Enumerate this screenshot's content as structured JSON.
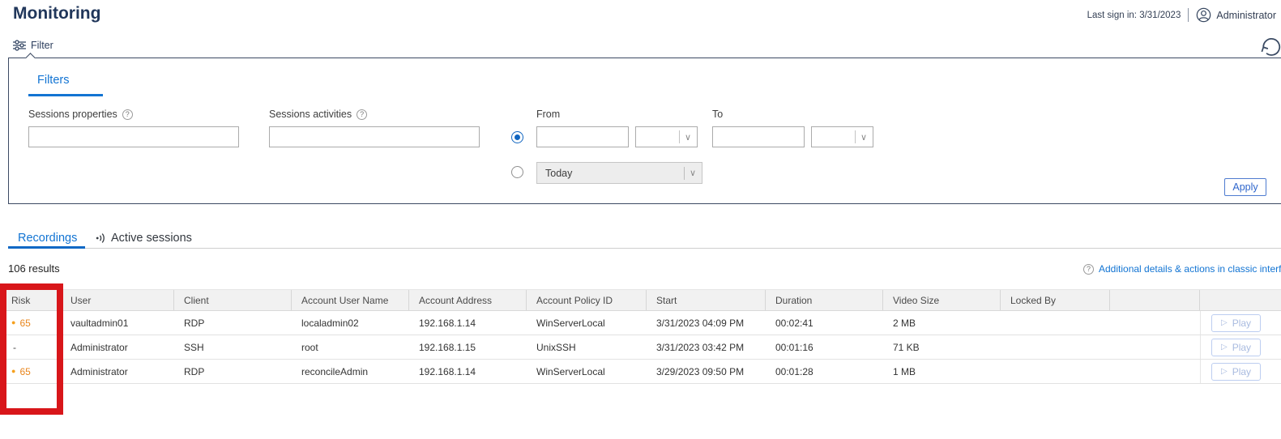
{
  "header": {
    "title": "Monitoring",
    "last_sign_in": "Last sign in: 3/31/2023",
    "user": "Administrator"
  },
  "filter_bar": {
    "label": "Filter"
  },
  "filters_panel": {
    "tab_label": "Filters",
    "sessions_properties_label": "Sessions properties",
    "sessions_activities_label": "Sessions activities",
    "from_label": "From",
    "to_label": "To",
    "predefined_range_value": "Today",
    "apply_label": "Apply"
  },
  "tabs": {
    "recordings": "Recordings",
    "active_sessions": "Active sessions"
  },
  "results_count": "106 results",
  "classic_link_label": "Additional details & actions in classic interface",
  "table": {
    "columns": [
      "Risk",
      "User",
      "Client",
      "Account User Name",
      "Account Address",
      "Account Policy ID",
      "Start",
      "Duration",
      "Video Size",
      "Locked By",
      "",
      ""
    ],
    "play_label": "Play",
    "rows": [
      {
        "risk": "65",
        "user": "vaultadmin01",
        "client": "RDP",
        "account_user_name": "localadmin02",
        "account_address": "192.168.1.14",
        "account_policy_id": "WinServerLocal",
        "start": "3/31/2023 04:09 PM",
        "duration": "00:02:41",
        "video_size": "2 MB",
        "locked_by": ""
      },
      {
        "risk": "-",
        "user": "Administrator",
        "client": "SSH",
        "account_user_name": "root",
        "account_address": "192.168.1.15",
        "account_policy_id": "UnixSSH",
        "start": "3/31/2023 03:42 PM",
        "duration": "00:01:16",
        "video_size": "71 KB",
        "locked_by": ""
      },
      {
        "risk": "65",
        "user": "Administrator",
        "client": "RDP",
        "account_user_name": "reconcileAdmin",
        "account_address": "192.168.1.14",
        "account_policy_id": "WinServerLocal",
        "start": "3/29/2023 09:50 PM",
        "duration": "00:01:28",
        "video_size": "1 MB",
        "locked_by": ""
      }
    ]
  },
  "icons": {
    "help": "?",
    "chevron_down": "∨",
    "play": "▷",
    "risk_dot": "●"
  },
  "colors": {
    "accent_blue": "#1274d3",
    "navy": "#21375b",
    "risk_orange": "#e8851c",
    "annotation_red": "#d8161a",
    "header_gray": "#f1f1f1"
  }
}
